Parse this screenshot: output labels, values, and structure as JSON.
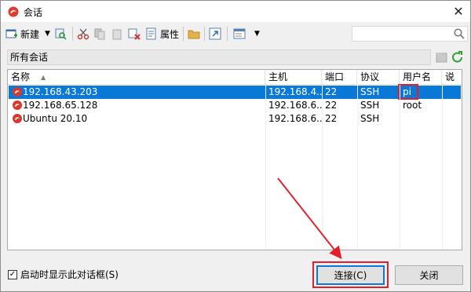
{
  "window": {
    "title": "会话",
    "close_glyph": "✕"
  },
  "toolbar": {
    "new_label": "新建",
    "properties_label": "属性",
    "search_placeholder": ""
  },
  "pathbar": {
    "text": "所有会话"
  },
  "list": {
    "columns": [
      {
        "label": "名称"
      },
      {
        "label": "主机"
      },
      {
        "label": "端口"
      },
      {
        "label": "协议"
      },
      {
        "label": "用户名"
      },
      {
        "label": "说明"
      }
    ],
    "rows": [
      {
        "name": "192.168.43.203",
        "host": "192.168.4...",
        "port": "22",
        "protocol": "SSH",
        "user": "pi",
        "desc": "",
        "selected": true,
        "icon": "session-snail-icon"
      },
      {
        "name": "192.168.65.128",
        "host": "192.168.6...",
        "port": "22",
        "protocol": "SSH",
        "user": "root",
        "desc": "",
        "selected": false,
        "icon": "session-snail-icon"
      },
      {
        "name": "Ubuntu 20.10",
        "host": "192.168.6...",
        "port": "22",
        "protocol": "SSH",
        "user": "",
        "desc": "",
        "selected": false,
        "icon": "session-snail-icon"
      }
    ]
  },
  "footer": {
    "startup_checkbox_label": "启动时显示此对话框(S)",
    "startup_checked": true,
    "connect_label": "连接(C)",
    "close_label": "关闭"
  },
  "colors": {
    "selection": "#0a78d7",
    "highlight_red": "#e0212b"
  }
}
